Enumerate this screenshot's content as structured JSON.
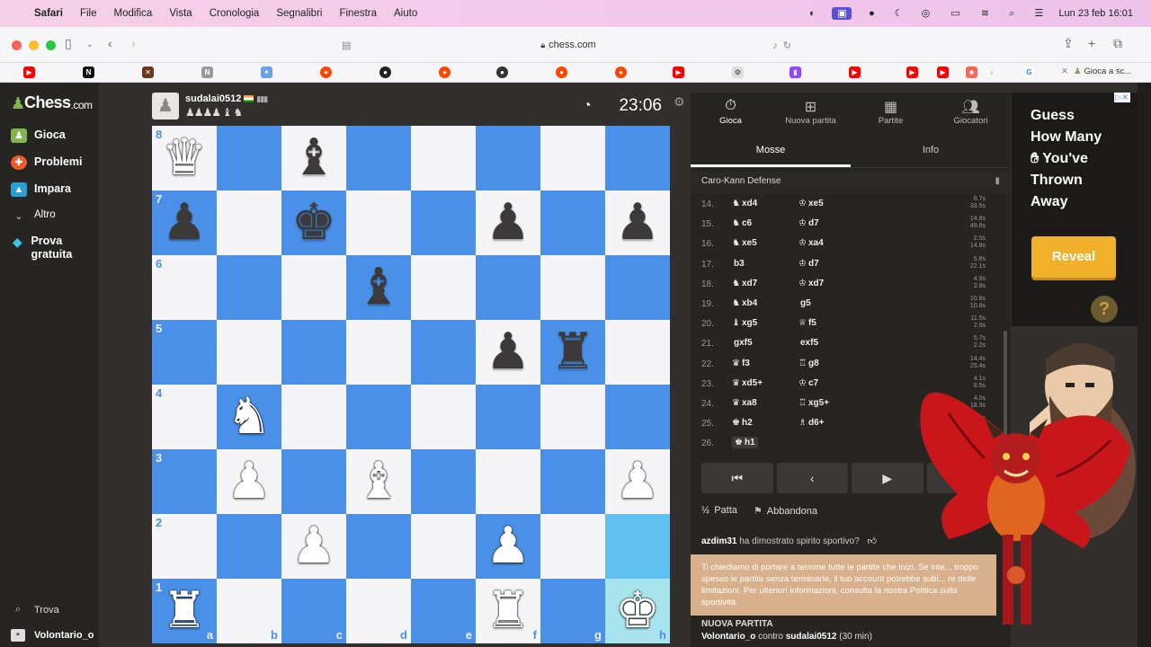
{
  "menubar": {
    "app": "Safari",
    "items": [
      "Modifica",
      "Vista",
      "Cronologia",
      "Segnalibri",
      "Finestra",
      "Aiuto"
    ],
    "file_label": "File",
    "clock": "Lun 23 feb  16:01"
  },
  "toolbar": {
    "url": "chess.com"
  },
  "favorites": {
    "last_tab": "Gioca a sc..."
  },
  "sidebar": {
    "logo": "Chess",
    "logo_suffix": ".com",
    "items": [
      {
        "label": "Gioca",
        "icon": "play-icon"
      },
      {
        "label": "Problemi",
        "icon": "puzzle-icon"
      },
      {
        "label": "Impara",
        "icon": "learn-icon"
      },
      {
        "label": "Altro",
        "icon": "chevron-down-icon"
      },
      {
        "label": "Prova gratuita",
        "icon": "diamond-icon"
      }
    ],
    "search_label": "Trova",
    "user_label": "Volontario_o"
  },
  "opponent": {
    "username": "sudalai0512",
    "captured": "♟♟♟♟ ♝ ♞",
    "clock": "23:06"
  },
  "board": {
    "colors": {
      "light": "#f5f5f7",
      "dark": "#4a90e8",
      "highlight_dark": "#62c0f0",
      "highlight_light": "#a8e4ee"
    },
    "ranks": [
      "8",
      "7",
      "6",
      "5",
      "4",
      "3",
      "2",
      "1"
    ],
    "files": [
      "a",
      "b",
      "c",
      "d",
      "e",
      "f",
      "g",
      "h"
    ],
    "pieces": [
      {
        "sq": "a8",
        "p": "♛",
        "c": "w",
        "name": "white-queen"
      },
      {
        "sq": "c8",
        "p": "♝",
        "c": "b",
        "name": "black-bishop"
      },
      {
        "sq": "a7",
        "p": "♟",
        "c": "b",
        "name": "black-pawn"
      },
      {
        "sq": "c7",
        "p": "♚",
        "c": "b",
        "name": "black-king"
      },
      {
        "sq": "f7",
        "p": "♟",
        "c": "b",
        "name": "black-pawn"
      },
      {
        "sq": "h7",
        "p": "♟",
        "c": "b",
        "name": "black-pawn"
      },
      {
        "sq": "d6",
        "p": "♝",
        "c": "b",
        "name": "black-bishop"
      },
      {
        "sq": "f5",
        "p": "♟",
        "c": "b",
        "name": "black-pawn"
      },
      {
        "sq": "g5",
        "p": "♜",
        "c": "b",
        "name": "black-rook"
      },
      {
        "sq": "b4",
        "p": "♞",
        "c": "w",
        "name": "white-knight"
      },
      {
        "sq": "b3",
        "p": "♟",
        "c": "w",
        "name": "white-pawn"
      },
      {
        "sq": "d3",
        "p": "♝",
        "c": "w",
        "name": "white-bishop"
      },
      {
        "sq": "h3",
        "p": "♟",
        "c": "w",
        "name": "white-pawn"
      },
      {
        "sq": "c2",
        "p": "♟",
        "c": "w",
        "name": "white-pawn"
      },
      {
        "sq": "f2",
        "p": "♟",
        "c": "w",
        "name": "white-pawn"
      },
      {
        "sq": "a1",
        "p": "♜",
        "c": "w",
        "name": "white-rook"
      },
      {
        "sq": "f1",
        "p": "♜",
        "c": "w",
        "name": "white-rook"
      },
      {
        "sq": "h1",
        "p": "♚",
        "c": "w",
        "name": "white-king"
      }
    ],
    "highlighted": [
      {
        "sq": "h2",
        "kind": "dark"
      },
      {
        "sq": "h1",
        "kind": "light"
      }
    ]
  },
  "panel": {
    "tabs": [
      {
        "label": "Gioca",
        "icon": "stopwatch-icon"
      },
      {
        "label": "Nuova partita",
        "icon": "plus-icon"
      },
      {
        "label": "Partite",
        "icon": "board-icon"
      },
      {
        "label": "Giocatori",
        "icon": "players-icon"
      }
    ],
    "subtabs": [
      "Mosse",
      "Info"
    ],
    "opening": "Caro-Kann Defense",
    "moves": [
      {
        "n": "14.",
        "wp": "♞",
        "w": "xd4",
        "bp": "♔",
        "b": "xe5",
        "t": [
          "6.7s",
          "33.5s"
        ]
      },
      {
        "n": "15.",
        "wp": "♞",
        "w": "c6",
        "bp": "♔",
        "b": "d7",
        "t": [
          "14.8s",
          "49.8s"
        ]
      },
      {
        "n": "16.",
        "wp": "♞",
        "w": "xe5",
        "bp": "♔",
        "b": "xa4",
        "t": [
          "2.0s",
          "14.8s"
        ]
      },
      {
        "n": "17.",
        "wp": "",
        "w": "b3",
        "bp": "♔",
        "b": "d7",
        "t": [
          "5.8s",
          "22.1s"
        ]
      },
      {
        "n": "18.",
        "wp": "♞",
        "w": "xd7",
        "bp": "♔",
        "b": "xd7",
        "t": [
          "4.9s",
          "2.8s"
        ]
      },
      {
        "n": "19.",
        "wp": "♞",
        "w": "xb4",
        "bp": "",
        "b": "g5",
        "t": [
          "10.8s",
          "10.8s"
        ]
      },
      {
        "n": "20.",
        "wp": "♝",
        "w": "xg5",
        "bp": "♕",
        "b": "f5",
        "t": [
          "11.5s",
          "2.0s"
        ]
      },
      {
        "n": "21.",
        "wp": "",
        "w": "gxf5",
        "bp": "",
        "b": "exf5",
        "t": [
          "5.7s",
          "2.2s"
        ]
      },
      {
        "n": "22.",
        "wp": "♛",
        "w": "f3",
        "bp": "♖",
        "b": "g8",
        "t": [
          "14.4s",
          "25.4s"
        ]
      },
      {
        "n": "23.",
        "wp": "♛",
        "w": "xd5+",
        "bp": "♔",
        "b": "c7",
        "t": [
          "4.1s",
          "8.5s"
        ]
      },
      {
        "n": "24.",
        "wp": "♛",
        "w": "xa8",
        "bp": "♖",
        "b": "xg5+",
        "t": [
          "4.0s",
          "18.3s"
        ]
      },
      {
        "n": "25.",
        "wp": "♚",
        "w": "h2",
        "bp": "♗",
        "b": "d6+",
        "t": [
          "7.0s",
          "3.3s"
        ]
      },
      {
        "n": "26.",
        "wp": "♚",
        "w": "h1",
        "bp": "",
        "b": "",
        "t": []
      }
    ],
    "nav": [
      "first",
      "prev",
      "next",
      "last"
    ],
    "draw_label": "Patta",
    "draw_icon": "½",
    "resign_label": "Abbandona",
    "sportsman_user": "azdim31",
    "sportsman_text": "ha dimostrato spirito sportivo?",
    "warning": "Ti chiediamo di portare a termine tutte le partite che inizi. Se inte... troppo spesso le partite senza terminarle, il tuo account potrebbe subi... re delle limitazioni. Per ulteriori informazioni, consulta la nostra Politica sulla sportività.",
    "new_game_title": "NUOVA PARTITA",
    "new_game_white": "Volontario_o",
    "new_game_vs": "contro",
    "new_game_black": "sudalai0512",
    "new_game_time": "(30 min)"
  },
  "ad": {
    "lines": [
      "Guess",
      "How Many",
      "You've",
      "Thrown",
      "Away"
    ],
    "button": "Reveal"
  }
}
